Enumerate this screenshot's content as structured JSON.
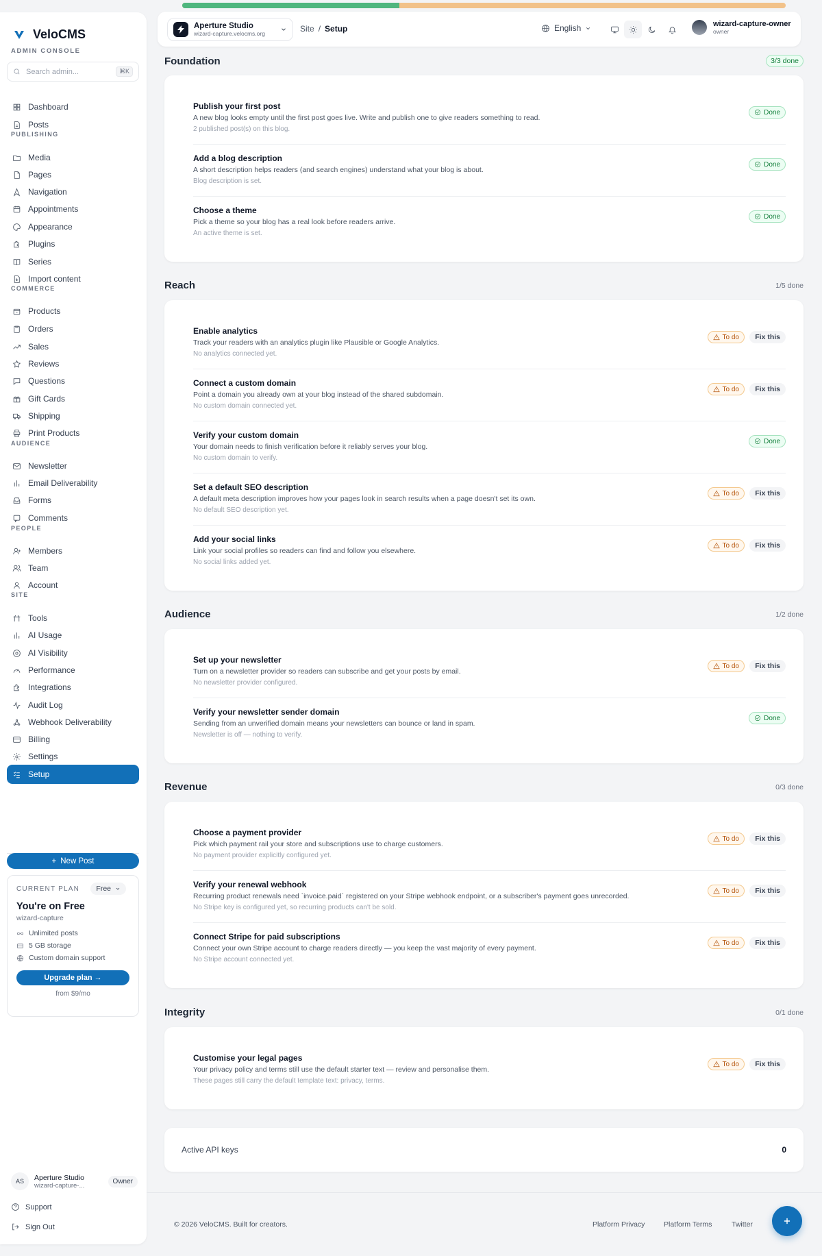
{
  "brand": {
    "name": "VeloCMS",
    "subtitle": "ADMIN CONSOLE"
  },
  "search": {
    "placeholder": "Search admin...",
    "shortcut": "⌘K"
  },
  "sidebar": {
    "items": [
      {
        "key": "dashboard",
        "label": "Dashboard",
        "icon": "grid-icon"
      },
      {
        "key": "posts",
        "label": "Posts",
        "icon": "document-icon"
      },
      {
        "key": "media",
        "label": "Media",
        "icon": "folder-icon"
      },
      {
        "key": "pages",
        "label": "Pages",
        "icon": "file-icon"
      },
      {
        "key": "navigation",
        "label": "Navigation",
        "icon": "navigation-icon"
      },
      {
        "key": "appointments",
        "label": "Appointments",
        "icon": "calendar-icon"
      },
      {
        "key": "appearance",
        "label": "Appearance",
        "icon": "palette-icon"
      },
      {
        "key": "plugins",
        "label": "Plugins",
        "icon": "puzzle-icon"
      },
      {
        "key": "series",
        "label": "Series",
        "icon": "book-icon"
      },
      {
        "key": "import",
        "label": "Import content",
        "icon": "import-icon"
      },
      {
        "key": "products",
        "label": "Products",
        "icon": "box-icon"
      },
      {
        "key": "orders",
        "label": "Orders",
        "icon": "clipboard-icon"
      },
      {
        "key": "sales",
        "label": "Sales",
        "icon": "trend-up-icon"
      },
      {
        "key": "reviews",
        "label": "Reviews",
        "icon": "star-icon"
      },
      {
        "key": "questions",
        "label": "Questions",
        "icon": "chat-icon"
      },
      {
        "key": "gift-cards",
        "label": "Gift Cards",
        "icon": "gift-icon"
      },
      {
        "key": "shipping",
        "label": "Shipping",
        "icon": "truck-icon"
      },
      {
        "key": "print-products",
        "label": "Print Products",
        "icon": "printer-icon"
      },
      {
        "key": "newsletter",
        "label": "Newsletter",
        "icon": "mail-icon"
      },
      {
        "key": "email-deliverability",
        "label": "Email Deliverability",
        "icon": "bar-chart-icon"
      },
      {
        "key": "forms",
        "label": "Forms",
        "icon": "inbox-icon"
      },
      {
        "key": "comments",
        "label": "Comments",
        "icon": "comment-icon"
      },
      {
        "key": "members",
        "label": "Members",
        "icon": "user-plus-icon"
      },
      {
        "key": "team",
        "label": "Team",
        "icon": "users-icon"
      },
      {
        "key": "account",
        "label": "Account",
        "icon": "user-icon"
      },
      {
        "key": "tools",
        "label": "Tools",
        "icon": "tools-icon"
      },
      {
        "key": "ai-usage",
        "label": "AI Usage",
        "icon": "bar-chart-icon"
      },
      {
        "key": "ai-visibility",
        "label": "AI Visibility",
        "icon": "eye-icon"
      },
      {
        "key": "performance",
        "label": "Performance",
        "icon": "gauge-icon"
      },
      {
        "key": "integrations",
        "label": "Integrations",
        "icon": "puzzle-icon"
      },
      {
        "key": "audit-log",
        "label": "Audit Log",
        "icon": "activity-icon"
      },
      {
        "key": "webhook-deliverability",
        "label": "Webhook Deliverability",
        "icon": "webhook-icon"
      },
      {
        "key": "billing",
        "label": "Billing",
        "icon": "credit-card-icon"
      },
      {
        "key": "settings",
        "label": "Settings",
        "icon": "gear-icon"
      },
      {
        "key": "setup",
        "label": "Setup",
        "icon": "checklist-icon",
        "active": true
      }
    ],
    "sections": [
      "PUBLISHING",
      "COMMERCE",
      "AUDIENCE",
      "PEOPLE",
      "SITE"
    ],
    "new_post": "New Post",
    "plan": {
      "label": "CURRENT PLAN",
      "badge": "Free",
      "title": "You're on Free",
      "site": "wizard-capture",
      "features": [
        "Unlimited posts",
        "5 GB storage",
        "Custom domain support"
      ],
      "upgrade": "Upgrade plan →",
      "from": "from $9/mo"
    },
    "account": {
      "initials": "AS",
      "name": "Aperture Studio",
      "sub": "wizard-capture-...",
      "role": "Owner"
    },
    "support": "Support",
    "sign_out": "Sign Out"
  },
  "topbar": {
    "site_name": "Aperture Studio",
    "site_domain": "wizard-capture.velocms.org",
    "breadcrumb": [
      "Site",
      "Setup"
    ],
    "language": "English",
    "user_name": "wizard-capture-owner",
    "user_role": "owner",
    "progress_fraction": 0.36
  },
  "sections": [
    {
      "title": "Foundation",
      "count": "3/3 done",
      "all_done": true,
      "tasks": [
        {
          "title": "Publish your first post",
          "desc": "A new blog looks empty until the first post goes live. Write and publish one to give readers something to read.",
          "note": "2 published post(s) on this blog.",
          "status": "Done"
        },
        {
          "title": "Add a blog description",
          "desc": "A short description helps readers (and search engines) understand what your blog is about.",
          "note": "Blog description is set.",
          "status": "Done"
        },
        {
          "title": "Choose a theme",
          "desc": "Pick a theme so your blog has a real look before readers arrive.",
          "note": "An active theme is set.",
          "status": "Done"
        }
      ]
    },
    {
      "title": "Reach",
      "count": "1/5 done",
      "tasks": [
        {
          "title": "Enable analytics",
          "desc": "Track your readers with an analytics plugin like Plausible or Google Analytics.",
          "note": "No analytics connected yet.",
          "status": "To do"
        },
        {
          "title": "Connect a custom domain",
          "desc": "Point a domain you already own at your blog instead of the shared subdomain.",
          "note": "No custom domain connected yet.",
          "status": "To do"
        },
        {
          "title": "Verify your custom domain",
          "desc": "Your domain needs to finish verification before it reliably serves your blog.",
          "note": "No custom domain to verify.",
          "status": "Done"
        },
        {
          "title": "Set a default SEO description",
          "desc": "A default meta description improves how your pages look in search results when a page doesn't set its own.",
          "note": "No default SEO description yet.",
          "status": "To do"
        },
        {
          "title": "Add your social links",
          "desc": "Link your social profiles so readers can find and follow you elsewhere.",
          "note": "No social links added yet.",
          "status": "To do"
        }
      ]
    },
    {
      "title": "Audience",
      "count": "1/2 done",
      "tasks": [
        {
          "title": "Set up your newsletter",
          "desc": "Turn on a newsletter provider so readers can subscribe and get your posts by email.",
          "note": "No newsletter provider configured.",
          "status": "To do"
        },
        {
          "title": "Verify your newsletter sender domain",
          "desc": "Sending from an unverified domain means your newsletters can bounce or land in spam.",
          "note": "Newsletter is off — nothing to verify.",
          "status": "Done"
        }
      ]
    },
    {
      "title": "Revenue",
      "count": "0/3 done",
      "tasks": [
        {
          "title": "Choose a payment provider",
          "desc": "Pick which payment rail your store and subscriptions use to charge customers.",
          "note": "No payment provider explicitly configured yet.",
          "status": "To do"
        },
        {
          "title": "Verify your renewal webhook",
          "desc": "Recurring product renewals need `invoice.paid` registered on your Stripe webhook endpoint, or a subscriber's payment goes unrecorded.",
          "note": "No Stripe key is configured yet, so recurring products can't be sold.",
          "status": "To do"
        },
        {
          "title": "Connect Stripe for paid subscriptions",
          "desc": "Connect your own Stripe account to charge readers directly — you keep the vast majority of every payment.",
          "note": "No Stripe account connected yet.",
          "status": "To do"
        }
      ]
    },
    {
      "title": "Integrity",
      "count": "0/1 done",
      "tasks": [
        {
          "title": "Customise your legal pages",
          "desc": "Your privacy policy and terms still use the default starter text — review and personalise them.",
          "note": "These pages still carry the default template text: privacy, terms.",
          "status": "To do"
        }
      ]
    }
  ],
  "fix_label": "Fix this",
  "api_keys": {
    "label": "Active API keys",
    "value": "0"
  },
  "footer": {
    "copyright": "© 2026 VeloCMS. Built for creators.",
    "links": [
      "Platform Privacy",
      "Platform Terms",
      "Twitter"
    ]
  },
  "colors": {
    "accent": "#1270b8",
    "done": "#15803d",
    "todo": "#b45309",
    "progress_done": "#4fb67e",
    "progress_remaining": "#f2c28a"
  }
}
